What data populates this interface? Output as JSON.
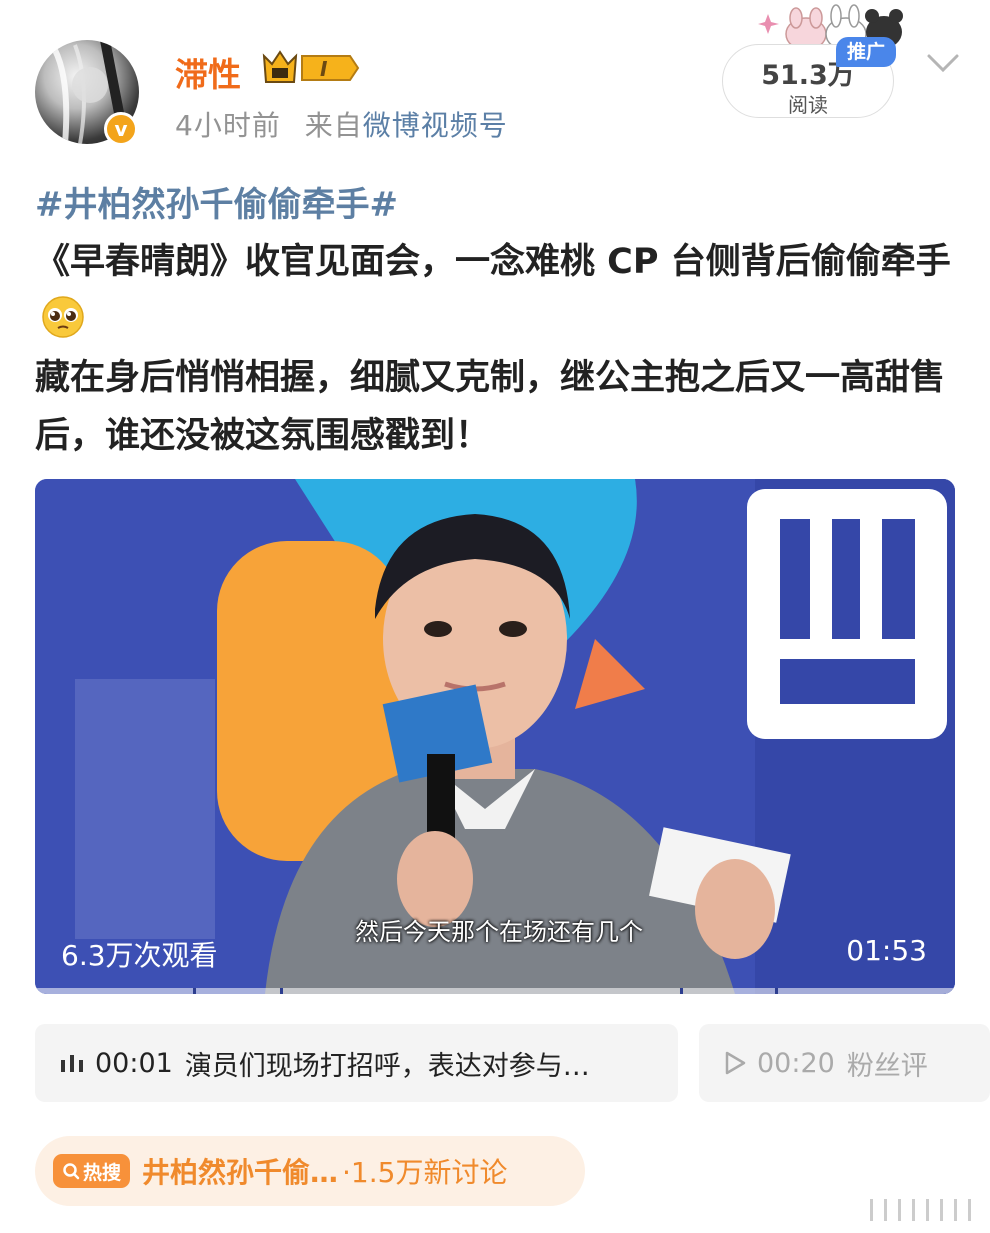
{
  "post": {
    "username": "滞性",
    "level_badge": "I",
    "avatar_badge": "v",
    "time": "4小时前",
    "from_label": "来自",
    "source": "微博视频号",
    "read_count": "51.3万",
    "read_label": "阅读",
    "promo_label": "推广",
    "hashtag": "#井柏然孙千偷偷牵手#",
    "lines": [
      "《早春晴朗》收官见面会，一念难桃 CP 台侧背后偷偷牵手",
      "藏在身后悄悄相握，细腻又克制，继公主抱之后又一高甜售后，谁还没被这氛围感戳到！"
    ]
  },
  "video": {
    "views": "6.3万次观看",
    "duration": "01:53",
    "subtitle": "然后今天那个在场还有几个"
  },
  "chapters": [
    {
      "icon": "audio-bars-icon",
      "time": "00:01",
      "text": "演员们现场打招呼，表达对参与…"
    },
    {
      "icon": "play-icon",
      "time": "00:20",
      "text": "粉丝评"
    }
  ],
  "hot_search": {
    "badge": "热搜",
    "topic": "井柏然孙千偷…",
    "count": "·1.5万新讨论"
  },
  "colors": {
    "username": "#f06b1a",
    "hashtag": "#5d7fa3",
    "promo": "#4a86ea",
    "hot_bg": "#fdf0e4",
    "hot_text": "#f08a2c"
  }
}
